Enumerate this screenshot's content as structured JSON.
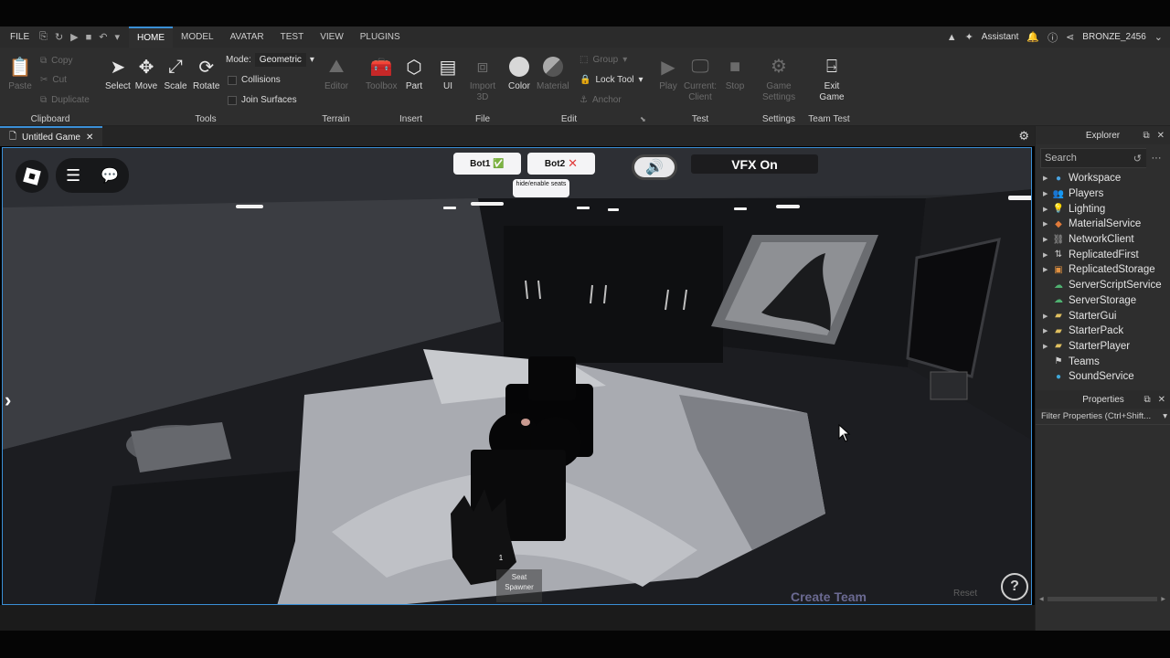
{
  "menubar": {
    "file": "FILE",
    "tabs": [
      "HOME",
      "MODEL",
      "AVATAR",
      "TEST",
      "VIEW",
      "PLUGINS"
    ],
    "active_tab": "HOME",
    "assistant": "Assistant",
    "username": "BRONZE_2456"
  },
  "ribbon": {
    "clipboard": {
      "paste": "Paste",
      "copy": "Copy",
      "cut": "Cut",
      "duplicate": "Duplicate",
      "label": "Clipboard"
    },
    "tools": {
      "select": "Select",
      "move": "Move",
      "scale": "Scale",
      "rotate": "Rotate",
      "mode_label": "Mode:",
      "mode_value": "Geometric",
      "collisions": "Collisions",
      "join_surfaces": "Join Surfaces",
      "label": "Tools"
    },
    "terrain": {
      "editor": "Editor",
      "label": "Terrain"
    },
    "insert": {
      "toolbox": "Toolbox",
      "part": "Part",
      "ui": "UI",
      "label": "Insert"
    },
    "file": {
      "import": "Import 3D",
      "label": "File"
    },
    "edit": {
      "color": "Color",
      "material": "Material",
      "group": "Group",
      "lock_tool": "Lock Tool",
      "anchor": "Anchor",
      "label": "Edit"
    },
    "test": {
      "play": "Play",
      "current_client": "Current: Client",
      "stop": "Stop",
      "label": "Test"
    },
    "settings": {
      "game_settings": "Game Settings",
      "label": "Settings"
    },
    "team_test": {
      "exit_game": "Exit Game",
      "label": "Team Test"
    }
  },
  "document_tab": {
    "title": "Untitled Game"
  },
  "game_ui": {
    "bot1": "Bot1",
    "bot1_status": "✅",
    "bot2": "Bot2",
    "bot2_status": "✕",
    "seat_toggle": "hide/enable seats",
    "vfx": "VFX On",
    "seat_number": "1",
    "seat_spawner": "Seat Spawner",
    "create_team": "Create Team",
    "reset": "Reset",
    "help": "?"
  },
  "explorer": {
    "title": "Explorer",
    "search_placeholder": "Search",
    "items": [
      {
        "label": "Workspace",
        "icon": "globe-icon",
        "color": "#4aa3e0",
        "expandable": true
      },
      {
        "label": "Players",
        "icon": "players-icon",
        "color": "#5aa0e0",
        "expandable": true
      },
      {
        "label": "Lighting",
        "icon": "bulb-icon",
        "color": "#f2d64b",
        "expandable": true
      },
      {
        "label": "MaterialService",
        "icon": "material-icon",
        "color": "#e07a3a",
        "expandable": true
      },
      {
        "label": "NetworkClient",
        "icon": "network-icon",
        "color": "#b0b0b0",
        "expandable": true
      },
      {
        "label": "ReplicatedFirst",
        "icon": "replicated-first-icon",
        "color": "#c8c8c8",
        "expandable": true
      },
      {
        "label": "ReplicatedStorage",
        "icon": "replicated-storage-icon",
        "color": "#e09040",
        "expandable": true
      },
      {
        "label": "ServerScriptService",
        "icon": "server-script-icon",
        "color": "#4fb070",
        "expandable": false
      },
      {
        "label": "ServerStorage",
        "icon": "server-storage-icon",
        "color": "#4fb070",
        "expandable": false
      },
      {
        "label": "StarterGui",
        "icon": "folder-icon",
        "color": "#e0c060",
        "expandable": true
      },
      {
        "label": "StarterPack",
        "icon": "folder-icon",
        "color": "#e0c060",
        "expandable": true
      },
      {
        "label": "StarterPlayer",
        "icon": "folder-icon",
        "color": "#e0c060",
        "expandable": true
      },
      {
        "label": "Teams",
        "icon": "teams-icon",
        "color": "#d0d0d0",
        "expandable": false
      },
      {
        "label": "SoundService",
        "icon": "sound-icon",
        "color": "#3fa7d8",
        "expandable": false
      }
    ]
  },
  "properties": {
    "title": "Properties",
    "filter_placeholder": "Filter Properties (Ctrl+Shift..."
  },
  "colors": {
    "accent": "#3a8fd6",
    "panel": "#2e2e2e",
    "create_team": "#6b6a92"
  }
}
